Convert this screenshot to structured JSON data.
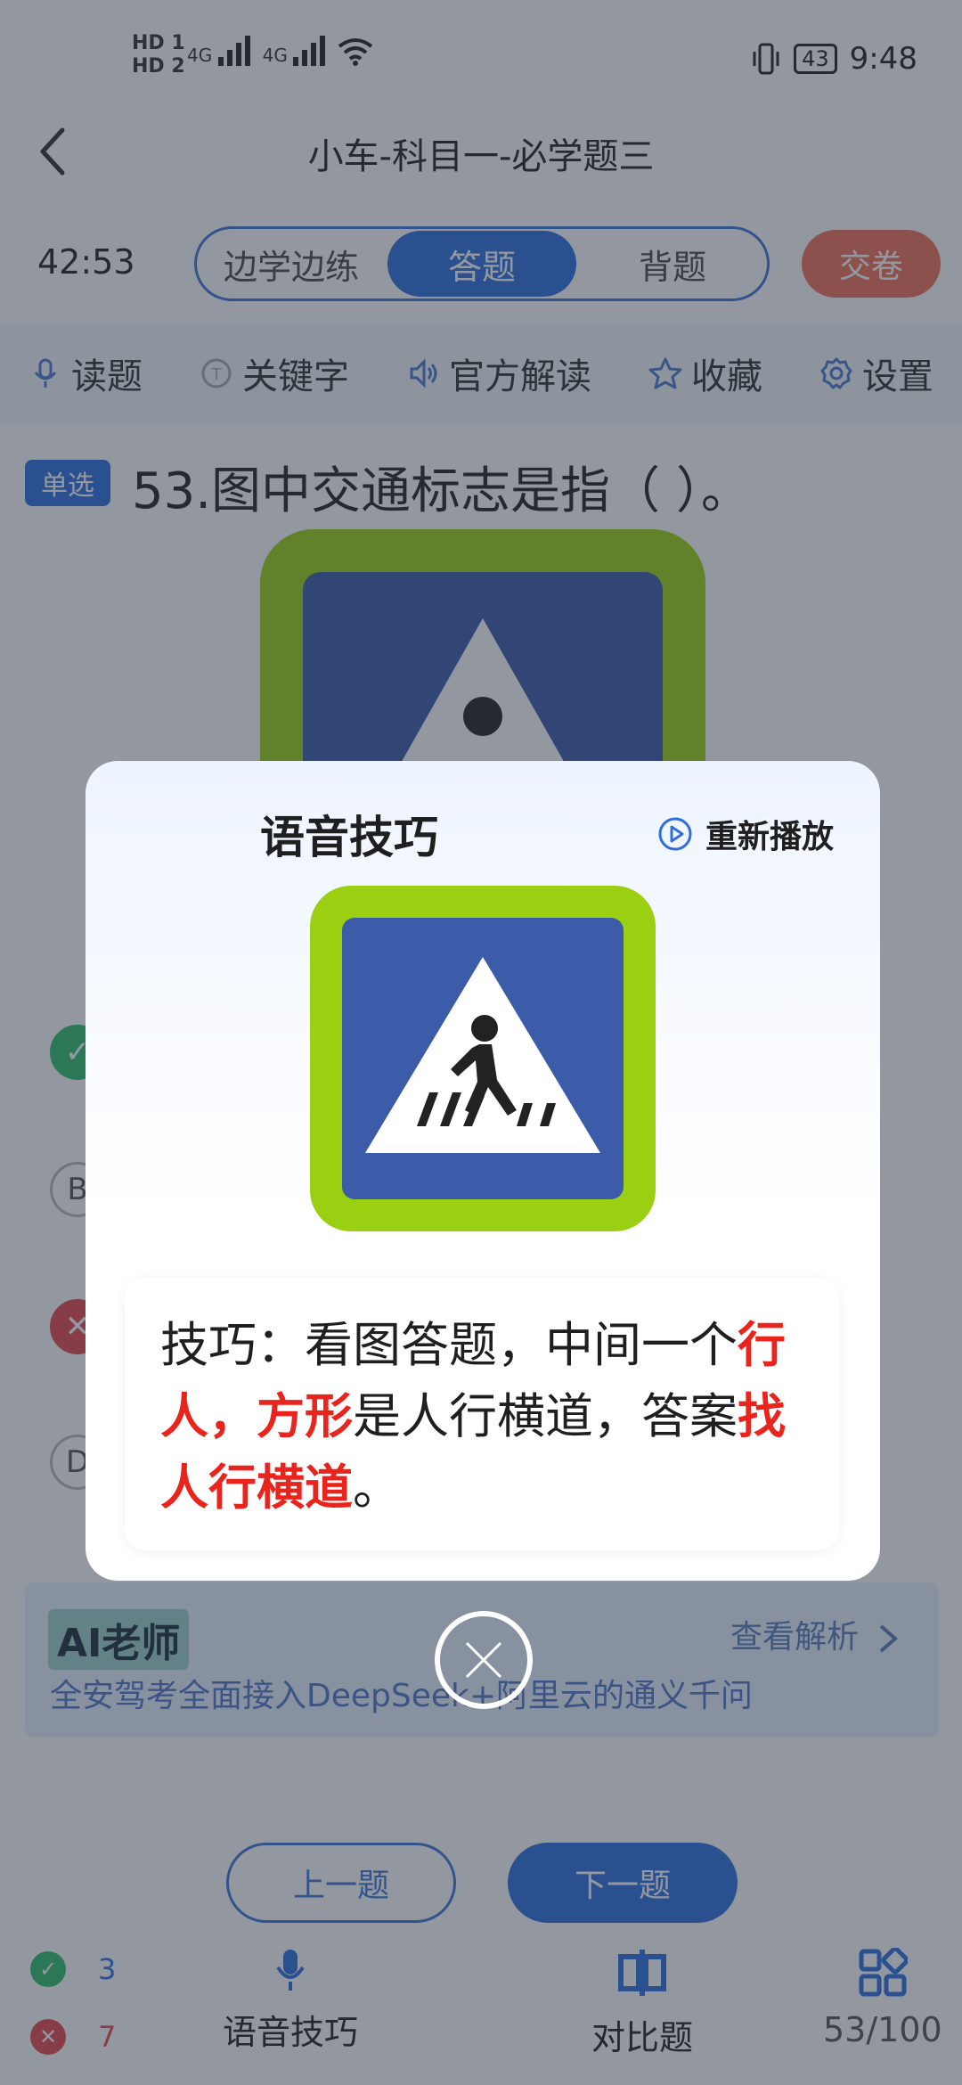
{
  "status_bar": {
    "hd1": "HD 1",
    "hd2": "HD 2",
    "net1": "4G",
    "net2": "4G",
    "battery": "43",
    "time": "9:48"
  },
  "header": {
    "title": "小车-科目一-必学题三"
  },
  "controls": {
    "timer": "42:53",
    "tabs": [
      "边学边练",
      "答题",
      "背题"
    ],
    "active_tab": "答题",
    "submit": "交卷"
  },
  "toolbar": {
    "items": [
      "读题",
      "关键字",
      "官方解读",
      "收藏",
      "设置"
    ]
  },
  "question": {
    "type_badge": "单选",
    "text": "53.图中交通标志是指（ ）。"
  },
  "options": {
    "b": "B",
    "d": "D"
  },
  "ai_card": {
    "title": "AI老师",
    "view_label": "查看解析",
    "subtitle": "全安驾考全面接入DeepSeek+阿里云的通义千问"
  },
  "nav": {
    "prev": "上一题",
    "next": "下一题"
  },
  "stats": {
    "correct": "3",
    "wrong": "7"
  },
  "bottom_bar": {
    "voice_tip": "语音技巧",
    "compare": "对比题",
    "progress": "53/100"
  },
  "modal": {
    "title": "语音技巧",
    "replay": "重新播放",
    "tip_prefix": "技巧：看图答题，中间一个",
    "tip_hl1": "行人，方形",
    "tip_mid": "是人行横道，答案",
    "tip_hl2": "找人行横道",
    "tip_end": "。"
  },
  "colors": {
    "primary": "#2f6fdc",
    "submit": "#f07058",
    "highlight": "#e8241d",
    "sign_green": "#9bd012",
    "sign_blue": "#3c5ba8"
  }
}
